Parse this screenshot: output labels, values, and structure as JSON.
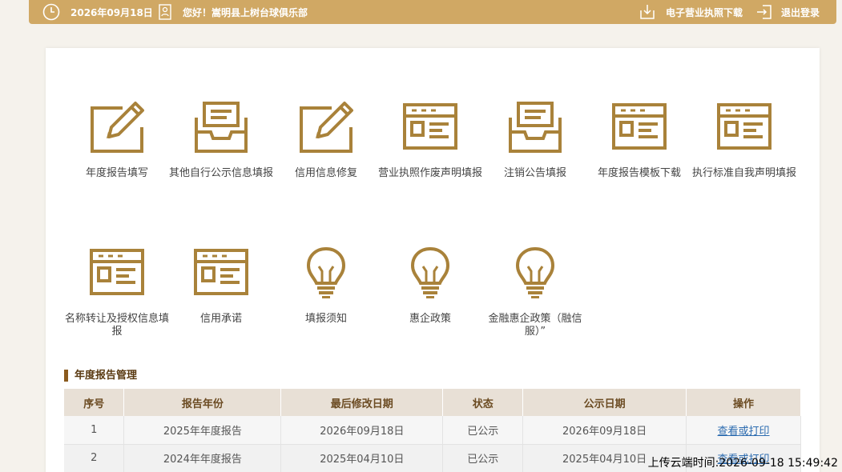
{
  "header": {
    "date": "2026年09月18日",
    "greeting": "您好！嵩明县上树台球俱乐部",
    "download_license": "电子营业执照下载",
    "logout": "退出登录"
  },
  "accent_color": "#b08a3e",
  "tiles": [
    {
      "label": "年度报告填写",
      "icon": "edit-pencil-icon"
    },
    {
      "label": "其他自行公示信息填报",
      "icon": "inbox-tray-icon"
    },
    {
      "label": "信用信息修复",
      "icon": "edit-pencil-icon"
    },
    {
      "label": "营业执照作废声明填报",
      "icon": "id-card-icon"
    },
    {
      "label": "注销公告填报",
      "icon": "inbox-tray-icon"
    },
    {
      "label": "年度报告模板下载",
      "icon": "id-card-icon"
    },
    {
      "label": "执行标准自我声明填报",
      "icon": "id-card-icon"
    },
    {
      "label": "名称转让及授权信息填报",
      "icon": "id-card-icon"
    },
    {
      "label": "信用承诺",
      "icon": "id-card-icon"
    },
    {
      "label": "填报须知",
      "icon": "lightbulb-icon"
    },
    {
      "label": "惠企政策",
      "icon": "lightbulb-icon"
    },
    {
      "label": "金融惠企政策（融信服）”",
      "icon": "lightbulb-icon"
    }
  ],
  "section_title": "年度报告管理",
  "table": {
    "columns": [
      "序号",
      "报告年份",
      "最后修改日期",
      "状态",
      "公示日期",
      "操作"
    ],
    "rows": [
      [
        "1",
        "2025年年度报告",
        "2026年09月18日",
        "已公示",
        "2026年09月18日",
        "查看或打印"
      ],
      [
        "2",
        "2024年年度报告",
        "2025年04月10日",
        "已公示",
        "2025年04月10日",
        "查看或打印"
      ]
    ]
  },
  "upload_timestamp": "上传云端时间:2026-09-18 15:49:42"
}
